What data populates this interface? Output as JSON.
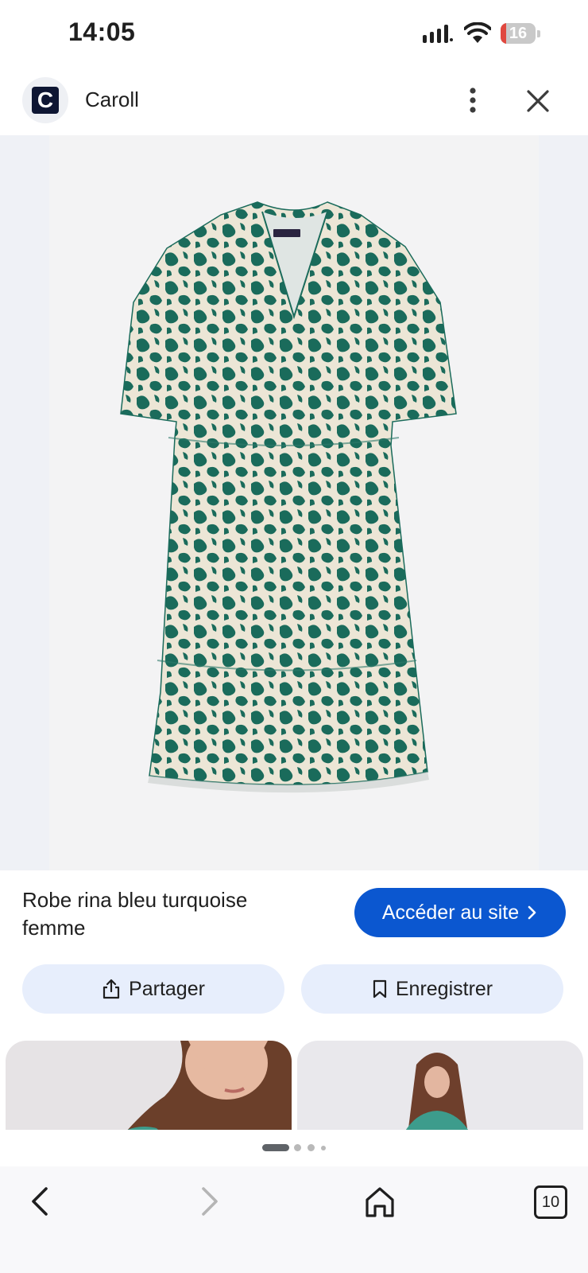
{
  "status_bar": {
    "time": "14:05",
    "battery": "16",
    "battery_level": 0.16
  },
  "header": {
    "logo_letter": "C",
    "brand": "Caroll"
  },
  "product": {
    "title": "Robe rina bleu turquoise femme",
    "visit_label": "Accéder au site",
    "share_label": "Partager",
    "save_label": "Enregistrer"
  },
  "nav": {
    "tab_count": "10"
  },
  "colors": {
    "accent": "#0b57d0",
    "chip_bg": "#e7eefc",
    "dress_green": "#1a6b5b",
    "dress_cream": "#ece6d6"
  },
  "icons": {
    "signal": "signal-icon",
    "wifi": "wifi-icon",
    "more": "more-vert-icon",
    "close": "close-icon",
    "share": "share-icon",
    "bookmark": "bookmark-icon",
    "back": "back-icon",
    "forward": "forward-icon",
    "home": "home-icon"
  }
}
